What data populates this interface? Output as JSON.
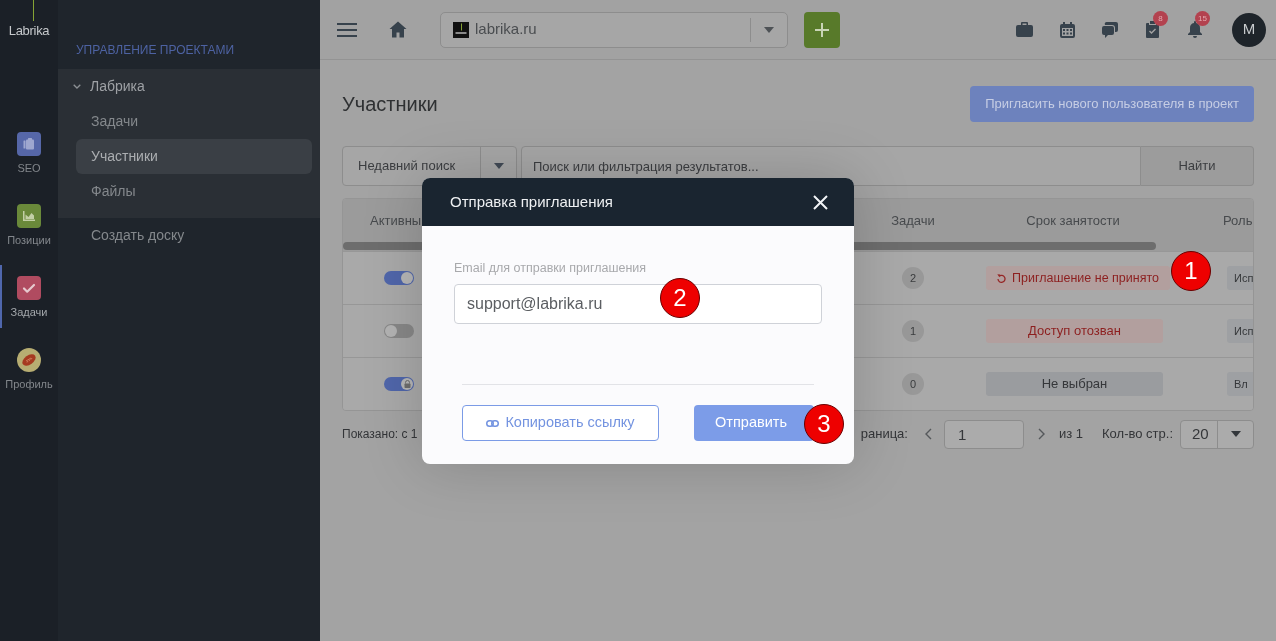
{
  "sidebar": {
    "logo": "Labrika",
    "items": [
      {
        "kind": "seo",
        "label": "SEO",
        "selected": false
      },
      {
        "kind": "positions",
        "label": "Позиции",
        "selected": false
      },
      {
        "kind": "tasks",
        "label": "Задачи",
        "selected": true
      },
      {
        "kind": "profile",
        "label": "Профиль",
        "selected": false
      }
    ]
  },
  "nav": {
    "heading": "УПРАВЛЕНИЕ ПРОЕКТАМИ",
    "group": {
      "label": "Лабрика",
      "expanded": true,
      "items": [
        {
          "label": "Задачи",
          "selected": false
        },
        {
          "label": "Участники",
          "selected": true
        },
        {
          "label": "Файлы",
          "selected": false
        }
      ]
    },
    "items": [
      {
        "label": "Создать доску",
        "selected": false
      }
    ]
  },
  "topbar": {
    "site_select": {
      "value": "labrika.ru"
    },
    "icons": [
      {
        "kind": "briefcase"
      },
      {
        "kind": "calendar"
      },
      {
        "kind": "chat"
      },
      {
        "kind": "tasks",
        "badge": "8"
      },
      {
        "kind": "bell",
        "badge": "15"
      }
    ],
    "avatar": "M"
  },
  "page": {
    "title": "Участники",
    "invite_button": "Пригласить нового пользователя в проект",
    "recent_search": {
      "value": "Недавний поиск"
    },
    "search": {
      "placeholder": "Поиск или фильтрация результатов..."
    },
    "search_button": "Найти"
  },
  "table": {
    "columns": [
      "Активны",
      "Задачи",
      "Срок занятости",
      "Роль"
    ],
    "rows": [
      {
        "active": {
          "on": true,
          "locked": false
        },
        "tasks": "2",
        "term": {
          "kind": "pending",
          "text": "Приглашение не принято"
        },
        "role": "Исп"
      },
      {
        "active": {
          "on": false,
          "locked": false
        },
        "tasks": "1",
        "term": {
          "kind": "revoked",
          "text": "Доступ отозван"
        },
        "role": "Исп"
      },
      {
        "active": {
          "on": true,
          "locked": true
        },
        "tasks": "0",
        "term": {
          "kind": "unset",
          "text": "Не выбран"
        },
        "role": "Вл"
      }
    ]
  },
  "pagination": {
    "shown": "Показано: с 1",
    "page_label": "раница:",
    "page": "1",
    "of": "из 1",
    "per_page_label": "Кол-во стр.:",
    "per_page": "20"
  },
  "modal": {
    "title": "Отправка приглашения",
    "email": {
      "label": "Email для отправки приглашения",
      "value": "support@labrika.ru"
    },
    "copy_button": "Копировать ссылку",
    "send_button": "Отправить"
  },
  "annotations": [
    {
      "label": "1"
    },
    {
      "label": "2"
    },
    {
      "label": "3"
    }
  ]
}
